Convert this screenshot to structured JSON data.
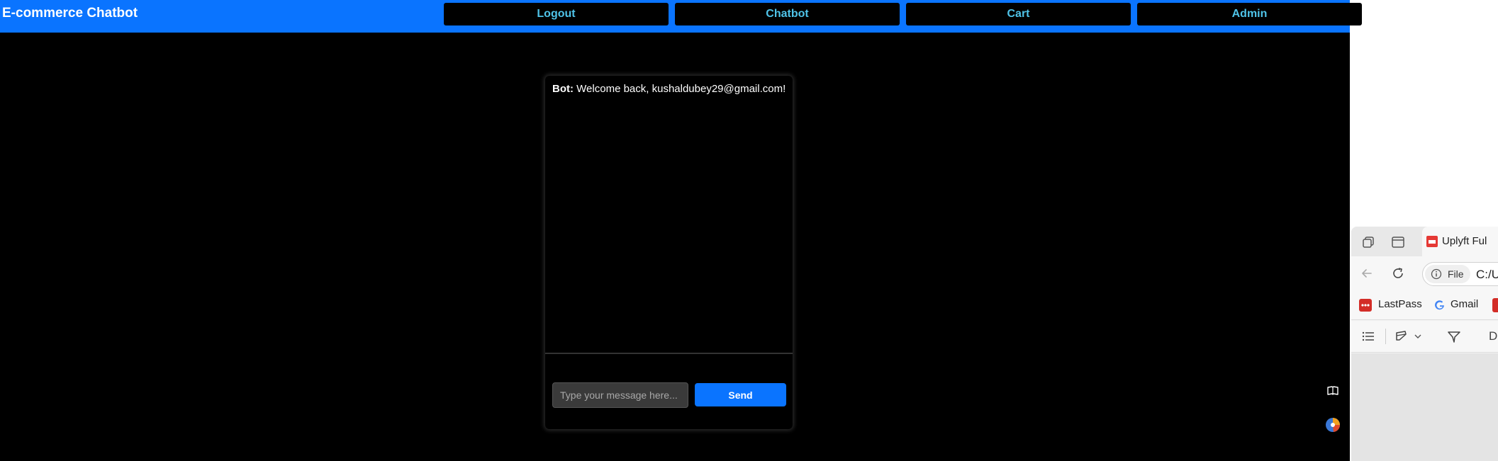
{
  "app": {
    "brand": "E-commerce Chatbot",
    "nav": {
      "logout": "Logout",
      "chatbot": "Chatbot",
      "cart": "Cart",
      "admin": "Admin"
    },
    "colors": {
      "accent": "#0a74ff",
      "nav_text": "#4fc3e8",
      "background": "#000000"
    }
  },
  "chat": {
    "messages": [
      {
        "sender": "Bot:",
        "text": "Welcome back, kushaldubey29@gmail.com!"
      }
    ],
    "input": {
      "value": "",
      "placeholder": "Type your message here..."
    },
    "send_label": "Send"
  },
  "side_window": {
    "tab_title": "Uplyft Ful",
    "address": {
      "chip": "File",
      "url": "C:/U"
    },
    "bookmarks": [
      "LastPass",
      "Gmail"
    ],
    "toolbar_text": "D",
    "icons": [
      "copy-tabs-icon",
      "tab-layout-icon",
      "pdf-icon",
      "back-arrow-icon",
      "reload-icon",
      "info-icon",
      "lastpass-icon",
      "google-icon",
      "list-icon",
      "highlighter-icon",
      "chevron-down-icon",
      "draw-icon"
    ]
  },
  "page_icons": [
    "book-icon",
    "extension-icon"
  ]
}
